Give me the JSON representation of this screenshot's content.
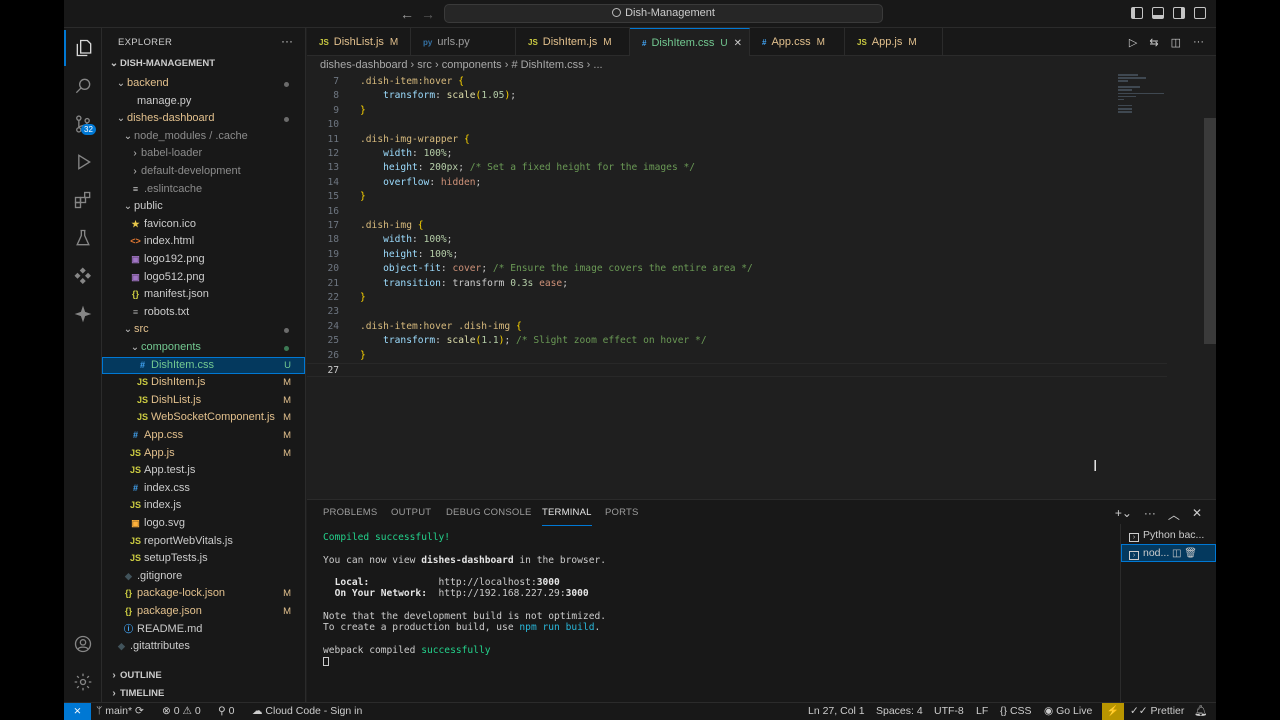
{
  "titlebar": {
    "search_text": "Dish-Management"
  },
  "activity": {
    "scm_badge": "32"
  },
  "sidebar": {
    "title": "EXPLORER",
    "root": "DISH-MANAGEMENT",
    "items": [
      {
        "label": "backend",
        "kind": "folder-open",
        "indent": 1,
        "deco": "dot",
        "color": "c-mod"
      },
      {
        "label": "manage.py",
        "kind": "file",
        "indent": 2,
        "icon": "",
        "color": "c-def"
      },
      {
        "label": "dishes-dashboard",
        "kind": "folder-open",
        "indent": 1,
        "deco": "dot",
        "color": "c-mod"
      },
      {
        "label": "node_modules / .cache",
        "kind": "folder-open",
        "indent": 2,
        "color": "c-dim"
      },
      {
        "label": "babel-loader",
        "kind": "folder",
        "indent": 3,
        "color": "c-dim"
      },
      {
        "label": "default-development",
        "kind": "folder",
        "indent": 3,
        "color": "c-dim"
      },
      {
        "label": ".eslintcache",
        "kind": "file",
        "indent": 3,
        "icon": "≡",
        "color": "c-dim"
      },
      {
        "label": "public",
        "kind": "folder-open",
        "indent": 2,
        "color": "c-def"
      },
      {
        "label": "favicon.ico",
        "kind": "file",
        "indent": 3,
        "icon": "★",
        "iconColor": "#e8c84a",
        "color": "c-def"
      },
      {
        "label": "index.html",
        "kind": "file",
        "indent": 3,
        "icon": "<>",
        "iconColor": "#e37933",
        "color": "c-def"
      },
      {
        "label": "logo192.png",
        "kind": "file",
        "indent": 3,
        "icon": "▣",
        "iconColor": "#a074c4",
        "color": "c-def"
      },
      {
        "label": "logo512.png",
        "kind": "file",
        "indent": 3,
        "icon": "▣",
        "iconColor": "#a074c4",
        "color": "c-def"
      },
      {
        "label": "manifest.json",
        "kind": "file",
        "indent": 3,
        "icon": "{}",
        "iconColor": "#cbcb41",
        "color": "c-def"
      },
      {
        "label": "robots.txt",
        "kind": "file",
        "indent": 3,
        "icon": "≡",
        "iconColor": "#a0a0a0",
        "color": "c-def"
      },
      {
        "label": "src",
        "kind": "folder-open",
        "indent": 2,
        "deco": "dot",
        "color": "c-mod"
      },
      {
        "label": "components",
        "kind": "folder-open",
        "indent": 3,
        "deco": "dot-green",
        "color": "c-new"
      },
      {
        "label": "DishItem.css",
        "kind": "file",
        "indent": 4,
        "icon": "#",
        "iconColor": "#42a5f5",
        "deco": "U",
        "color": "c-new",
        "selected": true
      },
      {
        "label": "DishItem.js",
        "kind": "file",
        "indent": 4,
        "icon": "JS",
        "iconColor": "#cbcb41",
        "deco": "M",
        "color": "c-mod"
      },
      {
        "label": "DishList.js",
        "kind": "file",
        "indent": 4,
        "icon": "JS",
        "iconColor": "#cbcb41",
        "deco": "M",
        "color": "c-mod"
      },
      {
        "label": "WebSocketComponent.js",
        "kind": "file",
        "indent": 4,
        "icon": "JS",
        "iconColor": "#cbcb41",
        "deco": "M",
        "color": "c-mod"
      },
      {
        "label": "App.css",
        "kind": "file",
        "indent": 3,
        "icon": "#",
        "iconColor": "#42a5f5",
        "deco": "M",
        "color": "c-mod"
      },
      {
        "label": "App.js",
        "kind": "file",
        "indent": 3,
        "icon": "JS",
        "iconColor": "#cbcb41",
        "deco": "M",
        "color": "c-mod"
      },
      {
        "label": "App.test.js",
        "kind": "file",
        "indent": 3,
        "icon": "JS",
        "iconColor": "#cbcb41",
        "color": "c-def"
      },
      {
        "label": "index.css",
        "kind": "file",
        "indent": 3,
        "icon": "#",
        "iconColor": "#42a5f5",
        "color": "c-def"
      },
      {
        "label": "index.js",
        "kind": "file",
        "indent": 3,
        "icon": "JS",
        "iconColor": "#cbcb41",
        "color": "c-def"
      },
      {
        "label": "logo.svg",
        "kind": "file",
        "indent": 3,
        "icon": "▣",
        "iconColor": "#ffb13b",
        "color": "c-def"
      },
      {
        "label": "reportWebVitals.js",
        "kind": "file",
        "indent": 3,
        "icon": "JS",
        "iconColor": "#cbcb41",
        "color": "c-def"
      },
      {
        "label": "setupTests.js",
        "kind": "file",
        "indent": 3,
        "icon": "JS",
        "iconColor": "#cbcb41",
        "color": "c-def"
      },
      {
        "label": ".gitignore",
        "kind": "file",
        "indent": 2,
        "icon": "◆",
        "iconColor": "#41535b",
        "color": "c-def"
      },
      {
        "label": "package-lock.json",
        "kind": "file",
        "indent": 2,
        "icon": "{}",
        "iconColor": "#cbcb41",
        "deco": "M",
        "color": "c-mod"
      },
      {
        "label": "package.json",
        "kind": "file",
        "indent": 2,
        "icon": "{}",
        "iconColor": "#cbcb41",
        "deco": "M",
        "color": "c-mod"
      },
      {
        "label": "README.md",
        "kind": "file",
        "indent": 2,
        "icon": "ⓘ",
        "iconColor": "#42a5f5",
        "color": "c-def"
      },
      {
        "label": ".gitattributes",
        "kind": "file",
        "indent": 1,
        "icon": "◆",
        "iconColor": "#41535b",
        "color": "c-def"
      }
    ],
    "outline": "OUTLINE",
    "timeline": "TIMELINE"
  },
  "tabs": [
    {
      "label": "DishList.js",
      "icon": "JS",
      "iconColor": "#cbcb41",
      "deco": "M",
      "decoColor": "#e2c08d"
    },
    {
      "label": "urls.py",
      "icon": "py",
      "iconColor": "#3572A5",
      "deco": "",
      "decoColor": ""
    },
    {
      "label": "DishItem.js",
      "icon": "JS",
      "iconColor": "#cbcb41",
      "deco": "M",
      "decoColor": "#e2c08d"
    },
    {
      "label": "DishItem.css",
      "icon": "#",
      "iconColor": "#42a5f5",
      "deco": "U",
      "decoColor": "#73c991",
      "active": true,
      "close": "✕"
    },
    {
      "label": "App.css",
      "icon": "#",
      "iconColor": "#42a5f5",
      "deco": "M",
      "decoColor": "#e2c08d"
    },
    {
      "label": "App.js",
      "icon": "JS",
      "iconColor": "#cbcb41",
      "deco": "M",
      "decoColor": "#e2c08d"
    }
  ],
  "breadcrumb": [
    "dishes-dashboard",
    "src",
    "components",
    "# DishItem.css",
    "..."
  ],
  "editor": {
    "current_line": 27,
    "lines": [
      {
        "n": 7,
        "t": [
          [
            "sel-t",
            ".dish-item:hover"
          ],
          [
            "pu",
            " "
          ],
          [
            "br",
            "{"
          ]
        ]
      },
      {
        "n": 8,
        "t": [
          [
            "pu",
            "    "
          ],
          [
            "prop",
            "transform"
          ],
          [
            "pu",
            ": "
          ],
          [
            "fn",
            "scale"
          ],
          [
            "br",
            "("
          ],
          [
            "num",
            "1.05"
          ],
          [
            "br",
            ")"
          ],
          [
            "pu",
            ";"
          ]
        ]
      },
      {
        "n": 9,
        "t": [
          [
            "br",
            "}"
          ]
        ]
      },
      {
        "n": 10,
        "t": []
      },
      {
        "n": 11,
        "t": [
          [
            "sel-t",
            ".dish-img-wrapper"
          ],
          [
            "pu",
            " "
          ],
          [
            "br",
            "{"
          ]
        ]
      },
      {
        "n": 12,
        "t": [
          [
            "pu",
            "    "
          ],
          [
            "prop",
            "width"
          ],
          [
            "pu",
            ": "
          ],
          [
            "num",
            "100%"
          ],
          [
            "pu",
            ";"
          ]
        ]
      },
      {
        "n": 13,
        "t": [
          [
            "pu",
            "    "
          ],
          [
            "prop",
            "height"
          ],
          [
            "pu",
            ": "
          ],
          [
            "num",
            "200px"
          ],
          [
            "pu",
            "; "
          ],
          [
            "cm",
            "/* Set a fixed height for the images */"
          ]
        ]
      },
      {
        "n": 14,
        "t": [
          [
            "pu",
            "    "
          ],
          [
            "prop",
            "overflow"
          ],
          [
            "pu",
            ": "
          ],
          [
            "val",
            "hidden"
          ],
          [
            "pu",
            ";"
          ]
        ]
      },
      {
        "n": 15,
        "t": [
          [
            "br",
            "}"
          ]
        ]
      },
      {
        "n": 16,
        "t": []
      },
      {
        "n": 17,
        "t": [
          [
            "sel-t",
            ".dish-img"
          ],
          [
            "pu",
            " "
          ],
          [
            "br",
            "{"
          ]
        ]
      },
      {
        "n": 18,
        "t": [
          [
            "pu",
            "    "
          ],
          [
            "prop",
            "width"
          ],
          [
            "pu",
            ": "
          ],
          [
            "num",
            "100%"
          ],
          [
            "pu",
            ";"
          ]
        ]
      },
      {
        "n": 19,
        "t": [
          [
            "pu",
            "    "
          ],
          [
            "prop",
            "height"
          ],
          [
            "pu",
            ": "
          ],
          [
            "num",
            "100%"
          ],
          [
            "pu",
            ";"
          ]
        ]
      },
      {
        "n": 20,
        "t": [
          [
            "pu",
            "    "
          ],
          [
            "prop",
            "object-fit"
          ],
          [
            "pu",
            ": "
          ],
          [
            "val",
            "cover"
          ],
          [
            "pu",
            "; "
          ],
          [
            "cm",
            "/* Ensure the image covers the entire area */"
          ]
        ]
      },
      {
        "n": 21,
        "t": [
          [
            "pu",
            "    "
          ],
          [
            "prop",
            "transition"
          ],
          [
            "pu",
            ": "
          ],
          [
            "pu",
            "transform "
          ],
          [
            "num",
            "0.3s"
          ],
          [
            "pu",
            " "
          ],
          [
            "val",
            "ease"
          ],
          [
            "pu",
            ";"
          ]
        ]
      },
      {
        "n": 22,
        "t": [
          [
            "br",
            "}"
          ]
        ]
      },
      {
        "n": 23,
        "t": []
      },
      {
        "n": 24,
        "t": [
          [
            "sel-t",
            ".dish-item:hover .dish-img"
          ],
          [
            "pu",
            " "
          ],
          [
            "br",
            "{"
          ]
        ]
      },
      {
        "n": 25,
        "t": [
          [
            "pu",
            "    "
          ],
          [
            "prop",
            "transform"
          ],
          [
            "pu",
            ": "
          ],
          [
            "fn",
            "scale"
          ],
          [
            "br",
            "("
          ],
          [
            "num",
            "1.1"
          ],
          [
            "br",
            ")"
          ],
          [
            "pu",
            "; "
          ],
          [
            "cm",
            "/* Slight zoom effect on hover */"
          ]
        ]
      },
      {
        "n": 26,
        "t": [
          [
            "br",
            "}"
          ]
        ]
      },
      {
        "n": 27,
        "t": []
      }
    ]
  },
  "panel": {
    "tabs": [
      "PROBLEMS",
      "OUTPUT",
      "DEBUG CONSOLE",
      "TERMINAL",
      "PORTS"
    ],
    "active_tab": "TERMINAL",
    "terminal_lines": [
      [
        [
          "t-green",
          "Compiled successfully!"
        ]
      ],
      [],
      [
        [
          "",
          "You can now view "
        ],
        [
          "t-bold",
          "dishes-dashboard"
        ],
        [
          "",
          " in the browser."
        ]
      ],
      [],
      [
        [
          "",
          "  "
        ],
        [
          "t-bold",
          "Local:"
        ],
        [
          "",
          "            http://localhost:"
        ],
        [
          "t-bold",
          "3000"
        ]
      ],
      [
        [
          "",
          "  "
        ],
        [
          "t-bold",
          "On Your Network:"
        ],
        [
          "",
          "  http://192.168.227.29:"
        ],
        [
          "t-bold",
          "3000"
        ]
      ],
      [],
      [
        [
          "",
          "Note that the development build is not optimized."
        ]
      ],
      [
        [
          "",
          "To create a production build, use "
        ],
        [
          "t-cyan",
          "npm run build"
        ],
        [
          "",
          "."
        ]
      ],
      [],
      [
        [
          "",
          "webpack compiled "
        ],
        [
          "t-green",
          "successfully"
        ]
      ]
    ],
    "terminals": [
      {
        "label": "Python bac...",
        "selected": false
      },
      {
        "label": "nod...",
        "selected": true
      }
    ]
  },
  "status": {
    "branch": "main*",
    "errors": "0",
    "warnings": "0",
    "ports": "0",
    "cloud": "Cloud Code - Sign in",
    "position": "Ln 27, Col 1",
    "spaces": "Spaces: 4",
    "encoding": "UTF-8",
    "eol": "LF",
    "language": "CSS",
    "golive": "Go Live",
    "prettier": "Prettier"
  }
}
